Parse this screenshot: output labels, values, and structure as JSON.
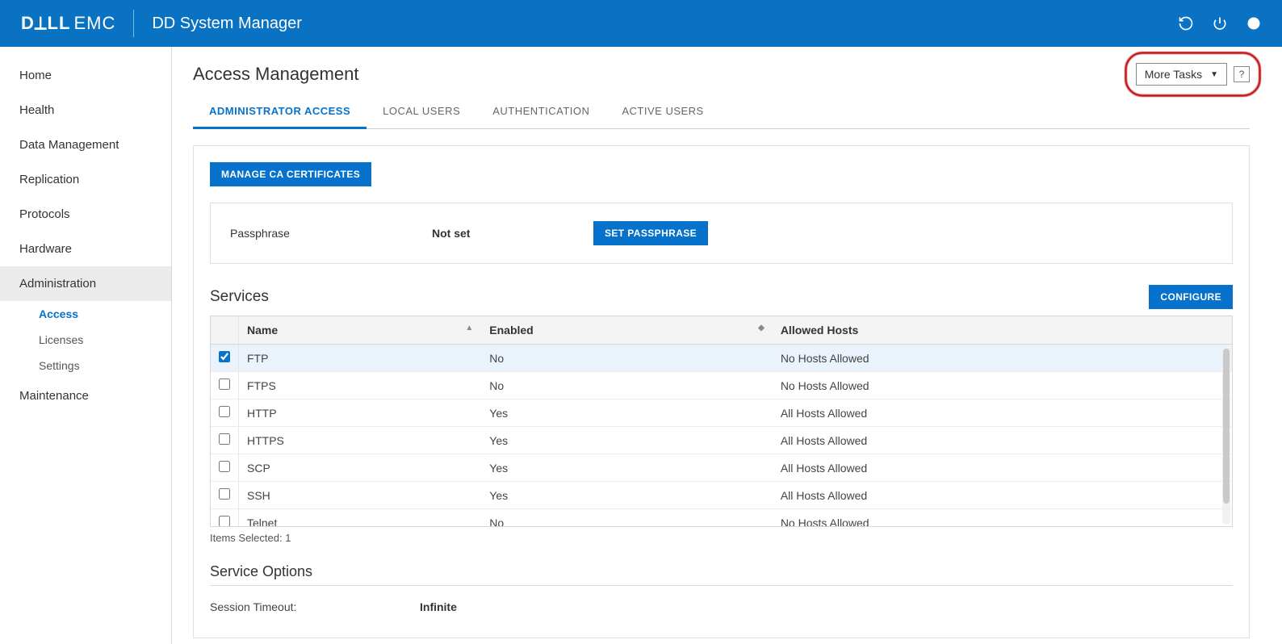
{
  "header": {
    "brand_dell": "D⟂LL",
    "brand_emc": "EMC",
    "app_title": "DD System Manager"
  },
  "sidebar": {
    "items": [
      {
        "label": "Home",
        "active": false
      },
      {
        "label": "Health",
        "active": false
      },
      {
        "label": "Data Management",
        "active": false
      },
      {
        "label": "Replication",
        "active": false
      },
      {
        "label": "Protocols",
        "active": false
      },
      {
        "label": "Hardware",
        "active": false
      },
      {
        "label": "Administration",
        "active": true,
        "children": [
          {
            "label": "Access",
            "active": true
          },
          {
            "label": "Licenses",
            "active": false
          },
          {
            "label": "Settings",
            "active": false
          }
        ]
      },
      {
        "label": "Maintenance",
        "active": false
      }
    ]
  },
  "page": {
    "title": "Access Management",
    "more_tasks_label": "More Tasks",
    "help_label": "?"
  },
  "tabs": [
    {
      "label": "ADMINISTRATOR ACCESS",
      "active": true
    },
    {
      "label": "LOCAL USERS",
      "active": false
    },
    {
      "label": "AUTHENTICATION",
      "active": false
    },
    {
      "label": "ACTIVE USERS",
      "active": false
    }
  ],
  "buttons": {
    "manage_ca": "MANAGE CA CERTIFICATES",
    "set_passphrase": "SET PASSPHRASE",
    "configure": "CONFIGURE"
  },
  "passphrase": {
    "label": "Passphrase",
    "value": "Not set"
  },
  "services": {
    "title": "Services",
    "columns": {
      "name": "Name",
      "enabled": "Enabled",
      "allowed": "Allowed Hosts"
    },
    "rows": [
      {
        "name": "FTP",
        "enabled": "No",
        "allowed": "No Hosts Allowed",
        "checked": true
      },
      {
        "name": "FTPS",
        "enabled": "No",
        "allowed": "No Hosts Allowed",
        "checked": false
      },
      {
        "name": "HTTP",
        "enabled": "Yes",
        "allowed": "All Hosts Allowed",
        "checked": false
      },
      {
        "name": "HTTPS",
        "enabled": "Yes",
        "allowed": "All Hosts Allowed",
        "checked": false
      },
      {
        "name": "SCP",
        "enabled": "Yes",
        "allowed": "All Hosts Allowed",
        "checked": false
      },
      {
        "name": "SSH",
        "enabled": "Yes",
        "allowed": "All Hosts Allowed",
        "checked": false
      },
      {
        "name": "Telnet",
        "enabled": "No",
        "allowed": "No Hosts Allowed",
        "checked": false
      }
    ],
    "items_selected_prefix": "Items Selected: ",
    "items_selected_count": "1"
  },
  "service_options": {
    "title": "Service Options",
    "session_timeout_label": "Session Timeout:",
    "session_timeout_value": "Infinite"
  }
}
